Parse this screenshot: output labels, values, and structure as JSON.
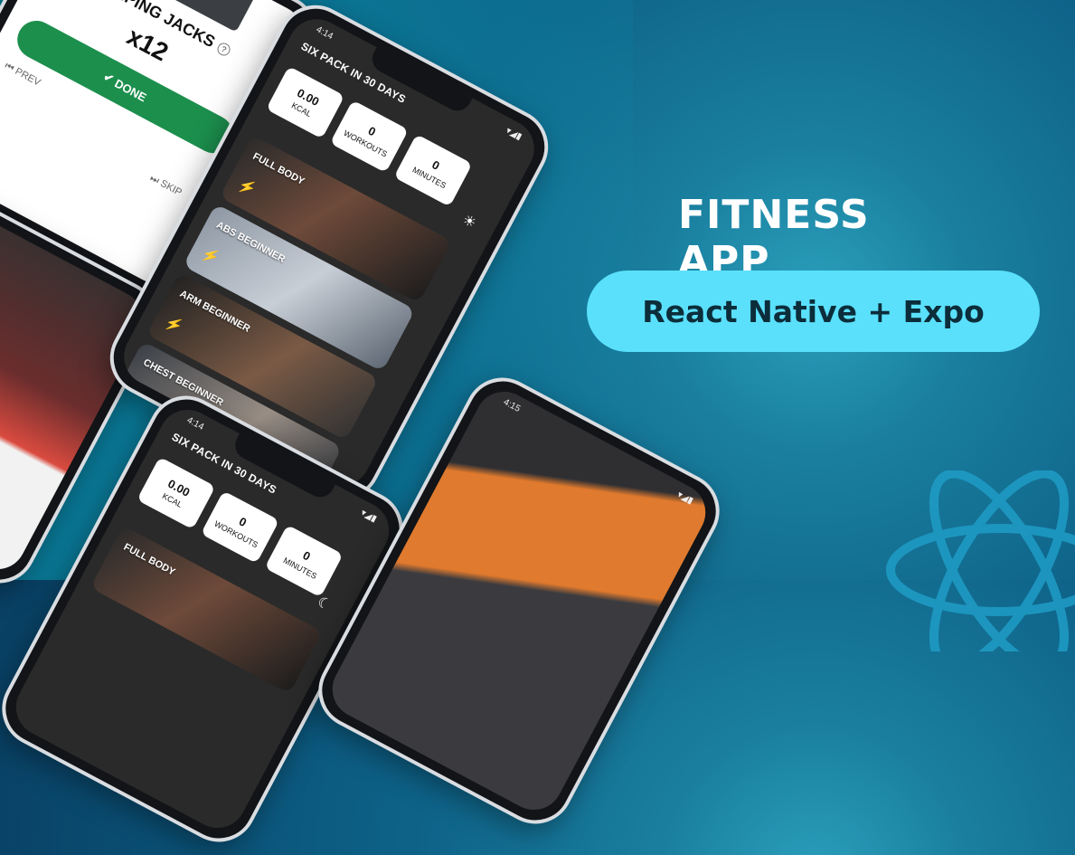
{
  "headline": "FITNESS APP",
  "pill": "React Native + Expo",
  "home": {
    "title": "SIX PACK IN 30 DAYS",
    "stats": [
      {
        "value": "0.00",
        "label": "KCAL"
      },
      {
        "value": "0",
        "label": "WORKOUTS"
      },
      {
        "value": "0",
        "label": "MINUTES"
      }
    ],
    "status_time": "4:14",
    "workouts": [
      "FULL BODY",
      "ABS BEGINNER",
      "ARM BEGINNER",
      "CHEST BEGINNER"
    ]
  },
  "exercise": {
    "name": "JUMPING JACKS",
    "reps": "x12",
    "done": "DONE",
    "prev": "PREV",
    "skip": "SKIP"
  },
  "video_phone": {
    "status_time": "4:15"
  },
  "colors": {
    "pill": "#5ae0fb",
    "done": "#1c8f4d",
    "bolt": "#ffd600"
  }
}
